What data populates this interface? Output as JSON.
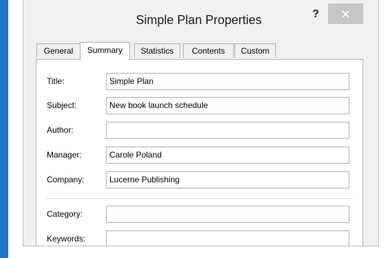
{
  "window": {
    "title": "Simple Plan Properties",
    "help_label": "?",
    "close_icon": "close-icon"
  },
  "tabs": [
    {
      "label": "General"
    },
    {
      "label": "Summary",
      "active": true
    },
    {
      "label": "Statistics"
    },
    {
      "label": "Contents"
    },
    {
      "label": "Custom"
    }
  ],
  "summary": {
    "fields": [
      {
        "label": "Title:",
        "value": "Simple Plan"
      },
      {
        "label": "Subject:",
        "value": "New book launch schedule"
      },
      {
        "label": "Author:",
        "value": ""
      },
      {
        "label": "Manager:",
        "value": "Carole Poland"
      },
      {
        "label": "Company:",
        "value": "Lucerne Publishing"
      },
      {
        "label": "Category:",
        "value": ""
      },
      {
        "label": "Keywords:",
        "value": ""
      }
    ]
  },
  "colors": {
    "accent_strip": "#1f78c8",
    "close_button_bg": "#c7c7c7",
    "dialog_bg": "#f0f0f0"
  }
}
